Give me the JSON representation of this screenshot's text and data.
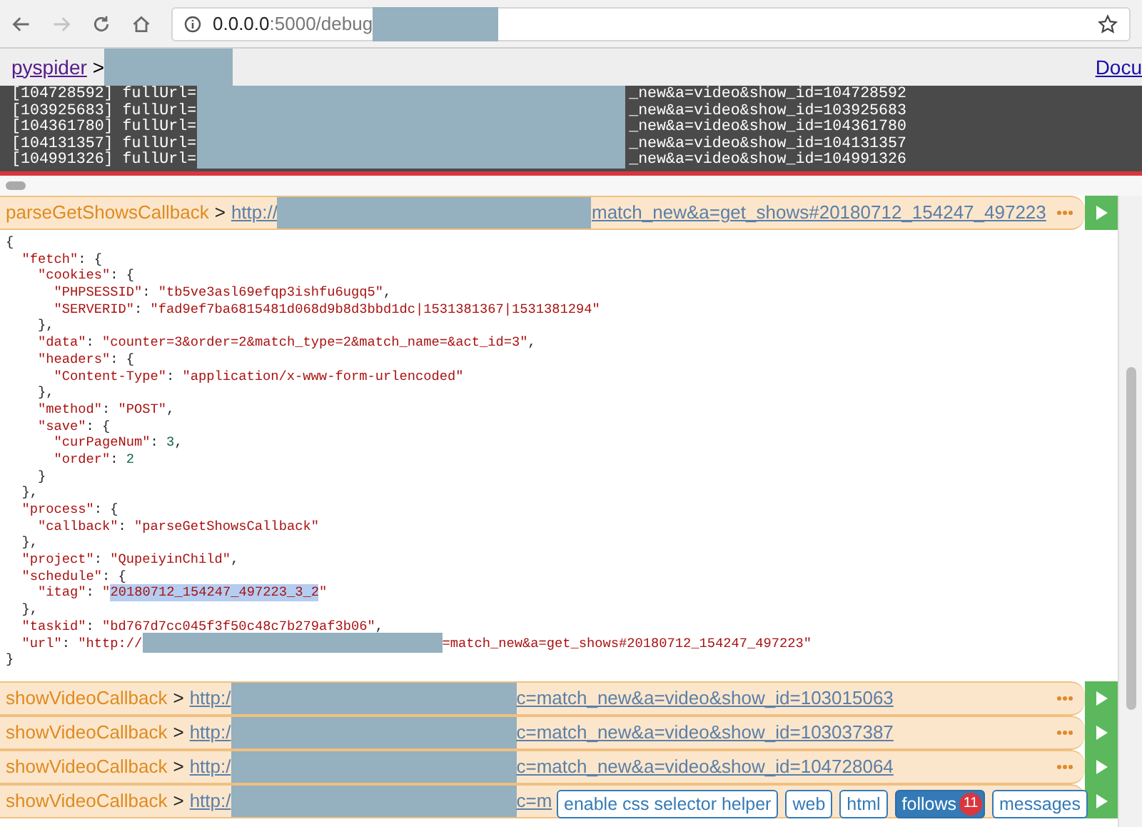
{
  "browser": {
    "nav": [
      {
        "kind": "back",
        "disabled": false
      },
      {
        "kind": "forward",
        "disabled": true
      },
      {
        "kind": "reload",
        "disabled": false
      },
      {
        "kind": "home",
        "disabled": false
      }
    ],
    "url_host": "0.0.0.0",
    "url_path": ":5000/debug"
  },
  "breadcrumb": {
    "root": "pyspider",
    "separator": ">",
    "right_link": "Docu"
  },
  "log": [
    {
      "prefix": "[104728592] fullUrl=",
      "suffix": "_new&a=video&show_id=104728592"
    },
    {
      "prefix": "[103925683] fullUrl=",
      "suffix": "_new&a=video&show_id=103925683"
    },
    {
      "prefix": "[104361780] fullUrl=",
      "suffix": "_new&a=video&show_id=104361780"
    },
    {
      "prefix": "[104131357] fullUrl=",
      "suffix": "_new&a=video&show_id=104131357"
    },
    {
      "prefix": "[104991326] fullUrl=",
      "suffix": "_new&a=video&show_id=104991326"
    }
  ],
  "task": {
    "callback": "parseGetShowsCallback",
    "separator": ">",
    "url_prefix": "http://",
    "url_suffix": "match_new&a=get_shows#20180712_154247_497223"
  },
  "result_lines": [
    [
      {
        "kind": "text",
        "text": "{"
      }
    ],
    [
      {
        "kind": "text",
        "text": "  \"fetch\": {"
      }
    ],
    [
      {
        "kind": "text",
        "text": "    \"cookies\": {"
      }
    ],
    [
      {
        "kind": "text",
        "text": "      \"PHPSESSID\": \"tb5ve3asl69efqp3ishfu6ugq5\","
      }
    ],
    [
      {
        "kind": "text",
        "text": "      \"SERVERID\": \"fad9ef7ba6815481d068d9b8d3bbd1dc|1531381367|1531381294\""
      }
    ],
    [
      {
        "kind": "text",
        "text": "    },"
      }
    ],
    [
      {
        "kind": "text",
        "text": "    \"data\": \"counter=3&order=2&match_type=2&match_name=&act_id=3\","
      }
    ],
    [
      {
        "kind": "text",
        "text": "    \"headers\": {"
      }
    ],
    [
      {
        "kind": "text",
        "text": "      \"Content-Type\": \"application/x-www-form-urlencoded\""
      }
    ],
    [
      {
        "kind": "text",
        "text": "    },"
      }
    ],
    [
      {
        "kind": "text",
        "text": "    \"method\": \"POST\","
      }
    ],
    [
      {
        "kind": "text",
        "text": "    \"save\": {"
      }
    ],
    [
      {
        "kind": "text",
        "text": "      \"curPageNum\": 3,"
      }
    ],
    [
      {
        "kind": "text",
        "text": "      \"order\": 2"
      }
    ],
    [
      {
        "kind": "text",
        "text": "    }"
      }
    ],
    [
      {
        "kind": "text",
        "text": "  },"
      }
    ],
    [
      {
        "kind": "text",
        "text": "  \"process\": {"
      }
    ],
    [
      {
        "kind": "text",
        "text": "    \"callback\": \"parseGetShowsCallback\""
      }
    ],
    [
      {
        "kind": "text",
        "text": "  },"
      }
    ],
    [
      {
        "kind": "text",
        "text": "  \"project\": \"QupeiyinChild\","
      }
    ],
    [
      {
        "kind": "text",
        "text": "  \"schedule\": {"
      }
    ],
    [
      {
        "kind": "text",
        "text": "    \"itag\": \""
      },
      {
        "kind": "selected",
        "text": "20180712_154247_497223_3_2"
      },
      {
        "kind": "text",
        "text": "\""
      }
    ],
    [
      {
        "kind": "text",
        "text": "  },"
      }
    ],
    [
      {
        "kind": "text",
        "text": "  \"taskid\": \"bd767d7cc045f3f50c48c7b279af3b06\","
      }
    ],
    [
      {
        "kind": "text",
        "text": "  \"url\": \"http://"
      },
      {
        "kind": "redacted"
      },
      {
        "kind": "string",
        "text": "=match_new&a=get_shows#20180712_154247_497223\""
      }
    ],
    [
      {
        "kind": "text",
        "text": "}"
      }
    ]
  ],
  "follows": [
    {
      "callback": "showVideoCallback",
      "separator": ">",
      "url_prefix": "http:/",
      "url_suffix": "c=match_new&a=video&show_id=103015063"
    },
    {
      "callback": "showVideoCallback",
      "separator": ">",
      "url_prefix": "http:/",
      "url_suffix": "c=match_new&a=video&show_id=103037387"
    },
    {
      "callback": "showVideoCallback",
      "separator": ">",
      "url_prefix": "http:/",
      "url_suffix": "c=match_new&a=video&show_id=104728064"
    },
    {
      "callback": "showVideoCallback",
      "separator": ">",
      "url_prefix": "http:/",
      "url_suffix": "c=m"
    }
  ],
  "bottom_tabs": [
    {
      "label": "enable css selector helper",
      "selected": false
    },
    {
      "label": "web",
      "selected": false
    },
    {
      "label": "html",
      "selected": false
    },
    {
      "label": "follows",
      "selected": true,
      "badge": "11"
    },
    {
      "label": "messages",
      "selected": false
    }
  ]
}
